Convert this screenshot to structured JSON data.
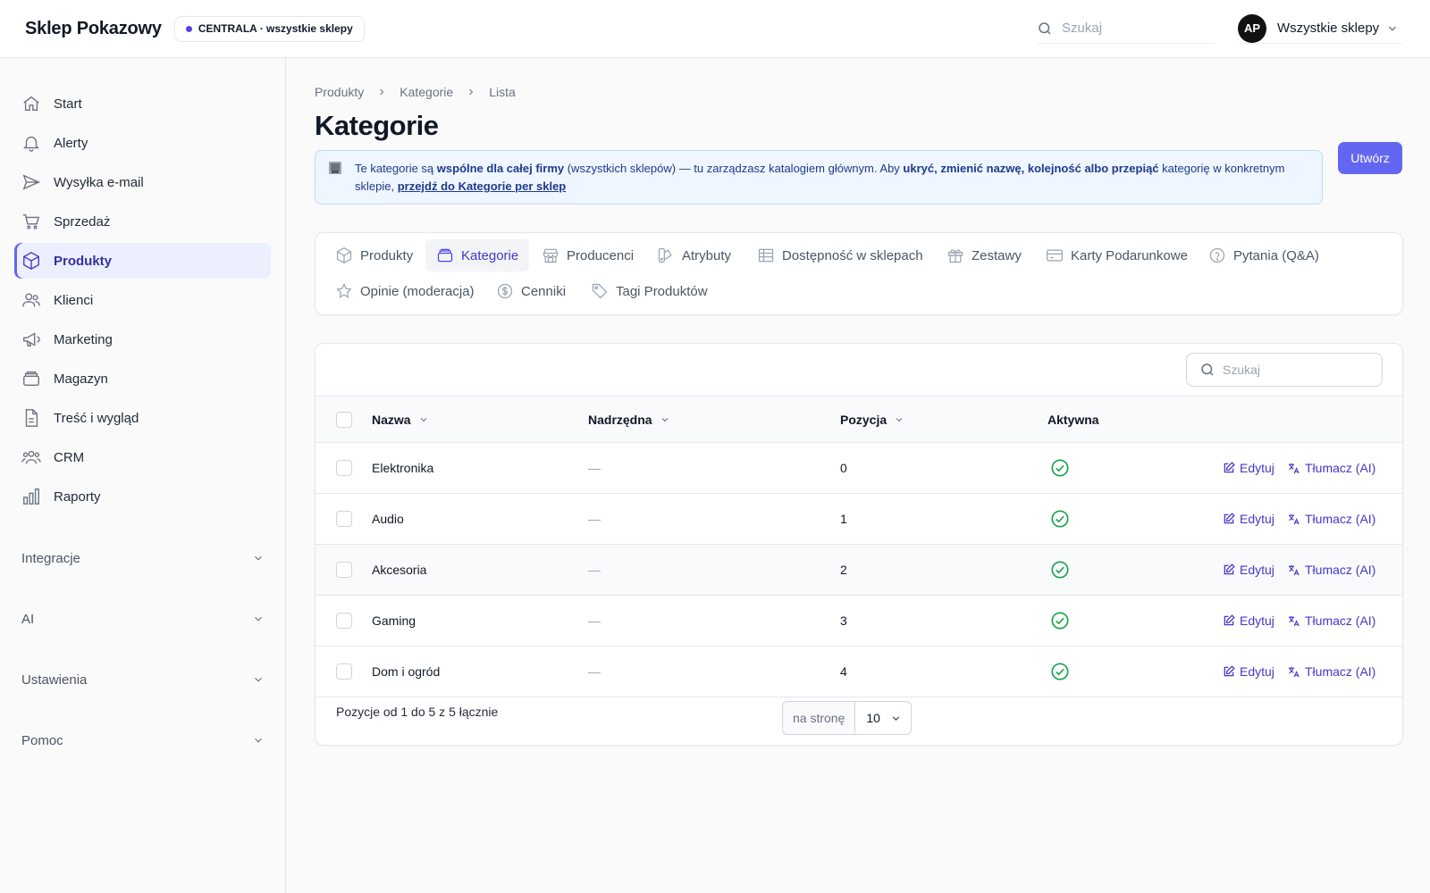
{
  "app": {
    "brand": "Sklep Pokazowy",
    "scope_badge": "CENTRALA · wszystkie sklepy",
    "search_placeholder": "Szukaj",
    "user_initials": "AP",
    "store_select": "Wszystkie sklepy"
  },
  "sidebar": {
    "items": [
      {
        "label": "Start",
        "icon": "home-icon"
      },
      {
        "label": "Alerty",
        "icon": "bell-icon"
      },
      {
        "label": "Wysyłka e-mail",
        "icon": "send-icon"
      },
      {
        "label": "Sprzedaż",
        "icon": "cart-icon"
      },
      {
        "label": "Produkty",
        "icon": "cube-icon",
        "active": true
      },
      {
        "label": "Klienci",
        "icon": "users-icon"
      },
      {
        "label": "Marketing",
        "icon": "megaphone-icon"
      },
      {
        "label": "Magazyn",
        "icon": "archive-icon"
      },
      {
        "label": "Treść i wygląd",
        "icon": "document-icon"
      },
      {
        "label": "CRM",
        "icon": "user-group-icon"
      },
      {
        "label": "Raporty",
        "icon": "chart-bar-icon"
      }
    ],
    "groups": [
      "Integracje",
      "AI",
      "Ustawienia",
      "Pomoc"
    ]
  },
  "page": {
    "breadcrumb": [
      "Produkty",
      "Kategorie",
      "Lista"
    ],
    "title": "Kategorie",
    "create_label": "Utwórz",
    "info": {
      "t1": "Te kategorie są ",
      "b1": "wspólne dla całej firmy",
      "t2": " (wszystkich sklepów) — tu zarządzasz katalogiem głównym. Aby ",
      "b2": "ukryć, zmienić nazwę, kolejność albo przepiąć",
      "t3": " kategorię w konkretnym sklepie, ",
      "link": "przejdź do Kategorie per sklep"
    }
  },
  "tabs": [
    {
      "label": "Produkty",
      "icon": "cube-icon"
    },
    {
      "label": "Kategorie",
      "icon": "archive-icon",
      "active": true
    },
    {
      "label": "Producenci",
      "icon": "storefront-icon"
    },
    {
      "label": "Atrybuty",
      "icon": "swatch-icon"
    },
    {
      "label": "Dostępność w sklepach",
      "icon": "table-icon"
    },
    {
      "label": "Zestawy",
      "icon": "gift-icon"
    },
    {
      "label": "Karty Podarunkowe",
      "icon": "card-icon"
    },
    {
      "label": "Pytania (Q&A)",
      "icon": "question-icon"
    },
    {
      "label": "Opinie (moderacja)",
      "icon": "star-icon"
    },
    {
      "label": "Cenniki",
      "icon": "dollar-icon"
    },
    {
      "label": "Tagi Produktów",
      "icon": "tag-icon"
    }
  ],
  "table": {
    "search_placeholder": "Szukaj",
    "columns": {
      "name": "Nazwa",
      "parent": "Nadrzędna",
      "position": "Pozycja",
      "active": "Aktywna"
    },
    "rows": [
      {
        "name": "Elektronika",
        "parent": "—",
        "position": "0",
        "active": true
      },
      {
        "name": "Audio",
        "parent": "—",
        "position": "1",
        "active": true
      },
      {
        "name": "Akcesoria",
        "parent": "—",
        "position": "2",
        "active": true
      },
      {
        "name": "Gaming",
        "parent": "—",
        "position": "3",
        "active": true
      },
      {
        "name": "Dom i ogród",
        "parent": "—",
        "position": "4",
        "active": true
      }
    ],
    "actions": {
      "edit": "Edytuj",
      "translate": "Tłumacz (AI)"
    },
    "footer": "Pozycje od 1 do 5 z 5 łącznie",
    "per_page_label": "na stronę",
    "per_page_value": "10"
  },
  "colors": {
    "accent": "#6366f1",
    "success": "#16a34a",
    "info_bg": "#eff6ff"
  }
}
